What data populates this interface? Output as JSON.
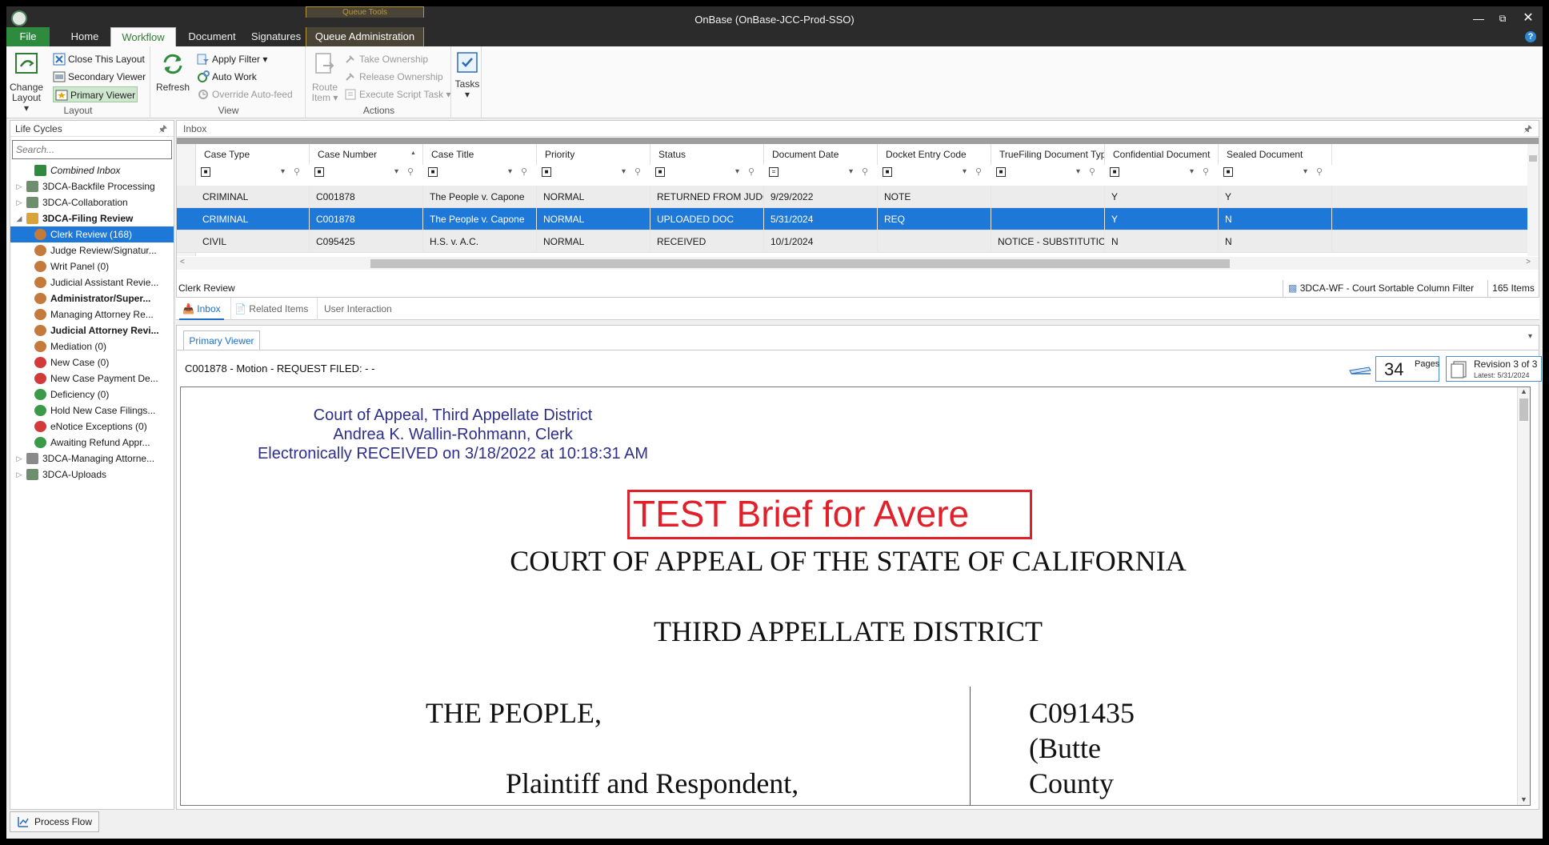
{
  "window": {
    "title": "OnBase (OnBase-JCC-Prod-SSO)",
    "contextual_group": "Queue Tools"
  },
  "tabs": {
    "file": "File",
    "home": "Home",
    "workflow": "Workflow",
    "document": "Document",
    "signatures": "Signatures",
    "queue_admin": "Queue Administration"
  },
  "ribbon": {
    "layout": {
      "label": "Layout",
      "change": "Change",
      "change2": "Layout",
      "close": "Close This Layout",
      "secondary": "Secondary Viewer",
      "primary": "Primary Viewer"
    },
    "view": {
      "label": "View",
      "refresh": "Refresh",
      "apply_filter": "Apply Filter",
      "auto_work": "Auto Work",
      "override": "Override Auto-feed"
    },
    "actions": {
      "label": "Actions",
      "route": "Route",
      "route2": "Item",
      "take": "Take Ownership",
      "release": "Release Ownership",
      "execute": "Execute Script Task"
    },
    "tasks": {
      "label": "Tasks"
    }
  },
  "lifecycles": {
    "header": "Life Cycles",
    "search_placeholder": "Search...",
    "items": [
      {
        "label": "Combined Inbox"
      },
      {
        "label": "3DCA-Backfile Processing"
      },
      {
        "label": "3DCA-Collaboration"
      },
      {
        "label": "3DCA-Filing Review"
      },
      {
        "label": "Clerk Review (168)"
      },
      {
        "label": "Judge Review/Signatur..."
      },
      {
        "label": "Writ Panel (0)"
      },
      {
        "label": "Judicial Assistant Revie..."
      },
      {
        "label": "Administrator/Super..."
      },
      {
        "label": "Managing Attorney Re..."
      },
      {
        "label": "Judicial Attorney Revi..."
      },
      {
        "label": "Mediation (0)"
      },
      {
        "label": "New Case (0)"
      },
      {
        "label": "New Case Payment De..."
      },
      {
        "label": "Deficiency (0)"
      },
      {
        "label": "Hold New Case Filings..."
      },
      {
        "label": "eNotice Exceptions (0)"
      },
      {
        "label": "Awaiting Refund Appr..."
      },
      {
        "label": "3DCA-Managing Attorne..."
      },
      {
        "label": "3DCA-Uploads"
      }
    ]
  },
  "inbox": {
    "header": "Inbox",
    "columns": [
      "Case Type",
      "Case Number",
      "Case Title",
      "Priority",
      "Status",
      "Document Date",
      "Docket Entry Code",
      "TrueFiling Document Type",
      "Confidential Document",
      "Sealed Document"
    ],
    "rows": [
      [
        "CRIMINAL",
        "C001878",
        "The People v. Capone",
        "NORMAL",
        "RETURNED FROM JUDGE",
        "9/29/2022",
        "NOTE",
        "",
        "Y",
        "Y"
      ],
      [
        "CRIMINAL",
        "C001878",
        "The People v. Capone",
        "NORMAL",
        "UPLOADED DOC",
        "5/31/2024",
        "REQ",
        "",
        "Y",
        "N"
      ],
      [
        "CIVIL",
        "C095425",
        "H.S. v. A.C.",
        "NORMAL",
        "RECEIVED",
        "10/1/2024",
        "",
        "NOTICE - SUBSTITUTION OF A",
        "N",
        "N"
      ]
    ],
    "status_left": "Clerk Review",
    "filter_name": "3DCA-WF - Court Sortable Column Filter",
    "item_count": "165 Items"
  },
  "subtabs": {
    "inbox": "Inbox",
    "related": "Related Items",
    "user": "User Interaction"
  },
  "viewer": {
    "tab": "Primary Viewer",
    "doc_title": "C001878 - Motion - REQUEST FILED: -  -",
    "pages_count": "34",
    "pages_label": "Pages",
    "revision": "Revision 3 of 3",
    "revision_latest": "Latest: 5/31/2024",
    "stamp": [
      "Court of Appeal, Third Appellate District",
      "Andrea K. Wallin-Rohmann, Clerk",
      "Electronically RECEIVED on 3/18/2022 at 10:18:31 AM"
    ],
    "test_brief": "TEST Brief for Avere",
    "court_title": "COURT OF APPEAL OF THE STATE OF CALIFORNIA",
    "district": "THIRD APPELLATE DISTRICT",
    "party": "THE PEOPLE,",
    "party_role": "Plaintiff and Respondent,",
    "case_no": "C091435",
    "county1": "(Butte",
    "county2": "County"
  },
  "bottom": {
    "process_flow": "Process Flow"
  },
  "colors": {
    "accent_green": "#2e8b3e",
    "selection_blue": "#1e78d7",
    "title_bar": "#2b2b2b",
    "stamp_red": "#e0202a",
    "stamp_blue": "#2e2f8c"
  }
}
